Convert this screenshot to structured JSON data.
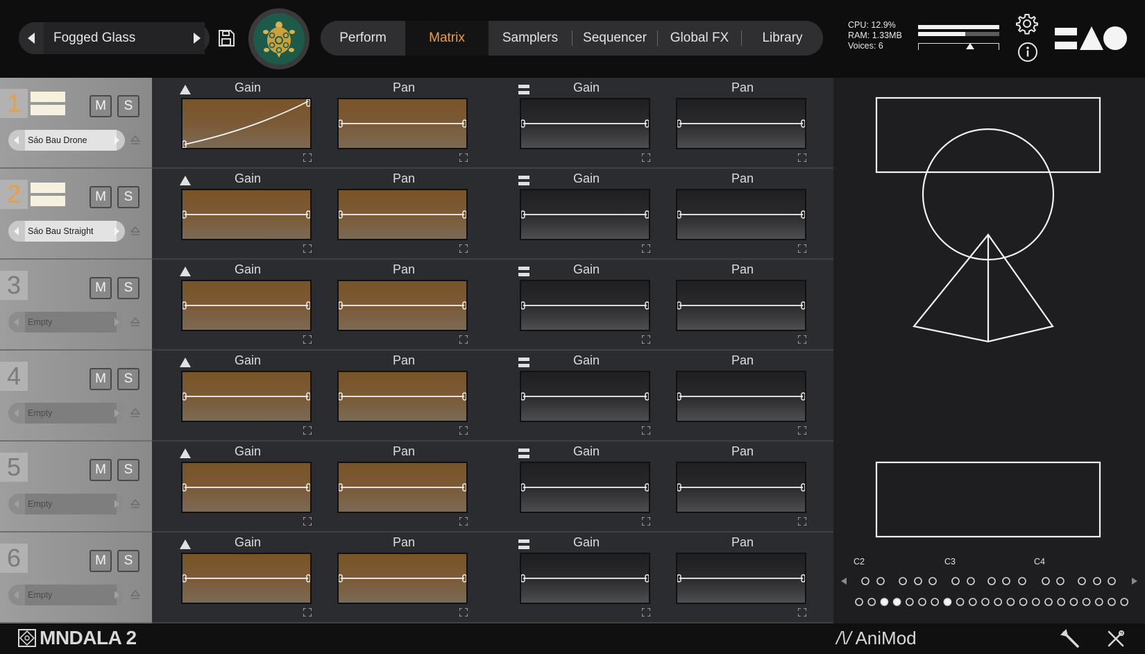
{
  "preset": {
    "name": "Fogged Glass"
  },
  "tabs": [
    {
      "label": "Perform",
      "active": false
    },
    {
      "label": "Matrix",
      "active": true
    },
    {
      "label": "Samplers",
      "active": false
    },
    {
      "label": "Sequencer",
      "active": false
    },
    {
      "label": "Global FX",
      "active": false
    },
    {
      "label": "Library",
      "active": false
    }
  ],
  "stats": {
    "cpu": "CPU: 12.9%",
    "ram": "RAM: 1.33MB",
    "voices": "Voices: 6"
  },
  "meter": {
    "bar1_fraction": 1.0,
    "bar2_fraction": 0.58,
    "slider_fraction": 0.64
  },
  "colors": {
    "accent": "#e9a23b",
    "warm_env": "#7a5428",
    "cool_env": "#2a2a2c",
    "bars": "#f6f1de"
  },
  "tracks": [
    {
      "number": "1",
      "sampler": "Sáo Bau Drone",
      "mute": "M",
      "solo": "S",
      "loaded": true
    },
    {
      "number": "2",
      "sampler": "Sáo Bau Straight",
      "mute": "M",
      "solo": "S",
      "loaded": true
    },
    {
      "number": "3",
      "sampler": "Empty",
      "mute": "M",
      "solo": "S",
      "loaded": false
    },
    {
      "number": "4",
      "sampler": "Empty",
      "mute": "M",
      "solo": "S",
      "loaded": false
    },
    {
      "number": "5",
      "sampler": "Empty",
      "mute": "M",
      "solo": "S",
      "loaded": false
    },
    {
      "number": "6",
      "sampler": "Empty",
      "mute": "M",
      "solo": "S",
      "loaded": false
    }
  ],
  "matrix": {
    "labels": {
      "gain": "Gain",
      "pan": "Pan"
    },
    "icons": {
      "left_group": "triangle-icon",
      "right_group": "bars-icon",
      "expand": "expand-icon"
    }
  },
  "keyboard": {
    "octave_labels": [
      "C2",
      "C3",
      "C4"
    ],
    "active_keys": [
      2,
      3,
      7
    ]
  },
  "footer": {
    "brand": "MNDALA 2",
    "animod": "AniMod"
  }
}
